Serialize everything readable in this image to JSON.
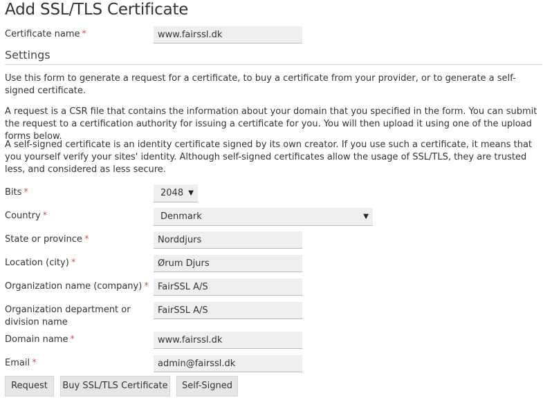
{
  "page": {
    "title": "Add SSL/TLS Certificate",
    "settings_title": "Settings",
    "required_marker": "*"
  },
  "certificate_name": {
    "label": "Certificate name",
    "value": "www.fairssl.dk"
  },
  "intro": {
    "p1": "Use this form to generate a request for a certificate, to buy a certificate from your provider, or to generate a self-signed certificate.",
    "p2": "A request is a CSR file that contains the information about your domain that you specified in the form. You can submit the request to a certification authority for issuing a certificate for you. You will then upload it using one of the upload forms below.",
    "p3": "A self-signed certificate is an identity certificate signed by its own creator. If you use such a certificate, it means that you yourself verify your sites' identity. Although self-signed certificates allow the usage of SSL/TLS, they are trusted less, and considered as less secure."
  },
  "form": {
    "bits": {
      "label": "Bits",
      "value": "2048"
    },
    "country": {
      "label": "Country",
      "value": "Denmark"
    },
    "state": {
      "label": "State or province",
      "value": "Norddjurs"
    },
    "location": {
      "label": "Location (city)",
      "value": "Ørum Djurs"
    },
    "organization": {
      "label": "Organization name (company)",
      "value": "FairSSL A/S"
    },
    "department": {
      "label": "Organization department or division name",
      "value": "FairSSL A/S"
    },
    "domain": {
      "label": "Domain name",
      "value": "www.fairssl.dk"
    },
    "email": {
      "label": "Email",
      "value": "admin@fairssl.dk"
    }
  },
  "buttons": {
    "request": "Request",
    "buy": "Buy SSL/TLS Certificate",
    "self_signed": "Self-Signed"
  }
}
